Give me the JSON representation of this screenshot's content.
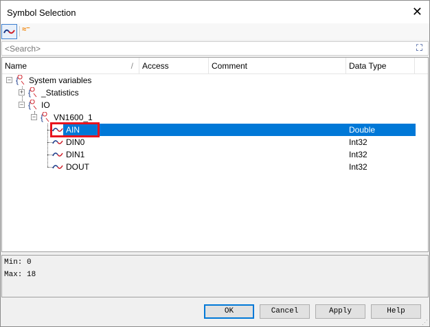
{
  "window": {
    "title": "Symbol Selection",
    "close": "✕"
  },
  "search": {
    "placeholder": "<Search>"
  },
  "columns": [
    "Name",
    "Access",
    "Comment",
    "Data Type"
  ],
  "tree": [
    {
      "label": "System variables",
      "type": "namespace",
      "expanded": true
    },
    {
      "label": "_Statistics",
      "type": "namespace",
      "expanded": false
    },
    {
      "label": "IO",
      "type": "namespace",
      "expanded": true
    },
    {
      "label": "VN1600_1",
      "type": "namespace",
      "expanded": true
    },
    {
      "label": "AIN",
      "type": "variable",
      "data_type": "Double",
      "selected": true
    },
    {
      "label": "DIN0",
      "type": "variable",
      "data_type": "Int32"
    },
    {
      "label": "DIN1",
      "type": "variable",
      "data_type": "Int32"
    },
    {
      "label": "DOUT",
      "type": "variable",
      "data_type": "Int32"
    }
  ],
  "info": {
    "min": "Min:  0",
    "max": "Max:  18"
  },
  "buttons": {
    "ok": "OK",
    "cancel": "Cancel",
    "apply": "Apply",
    "help": "Help"
  },
  "colors": {
    "selection": "#0078d7",
    "highlight": "#e8141e"
  }
}
